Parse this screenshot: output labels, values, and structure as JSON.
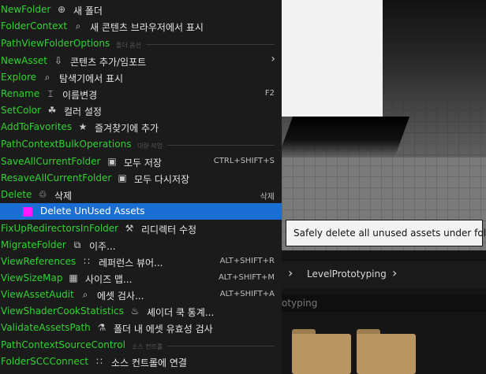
{
  "menu": {
    "items": [
      {
        "name": "NewFolder",
        "icon": "⊕",
        "label": "새 폴더",
        "shortcut": ""
      },
      {
        "name": "FolderContext",
        "icon": "⌕",
        "label": "새 콘텐츠 브라우저에서 표시",
        "shortcut": ""
      },
      {
        "name": "PathViewFolderOptions",
        "section": "폴더 옵션"
      },
      {
        "name": "NewAsset",
        "icon": "⇩",
        "label": "콘텐츠 추가/임포트",
        "shortcut": "",
        "submenu": "›"
      },
      {
        "name": "Explore",
        "icon": "⌕",
        "label": "탐색기에서 표시",
        "shortcut": ""
      },
      {
        "name": "Rename",
        "icon": "⌶",
        "label": "이름변경",
        "shortcut": "F2"
      },
      {
        "name": "SetColor",
        "icon": "☘",
        "label": "컬러 설정",
        "shortcut": ""
      },
      {
        "name": "AddToFavorites",
        "icon": "★",
        "label": "즐겨찾기에 추가",
        "shortcut": ""
      },
      {
        "name": "PathContextBulkOperations",
        "section": "대량 작업"
      },
      {
        "name": "SaveAllCurrentFolder",
        "icon": "▣",
        "label": "모두 저장",
        "shortcut": "CTRL+SHIFT+S"
      },
      {
        "name": "ResaveAllCurrentFolder",
        "icon": "▣",
        "label": "모두 다시저장",
        "shortcut": ""
      },
      {
        "name": "Delete",
        "icon": "♲",
        "label": "삭제",
        "shortcut": "삭제"
      },
      {
        "name": "",
        "icon": "",
        "label": "Delete UnUsed Assets",
        "shortcut": "",
        "selected": true
      },
      {
        "name": "FixUpRedirectorsInFolder",
        "icon": "⚒",
        "label": "리디렉터 수정",
        "shortcut": ""
      },
      {
        "name": "MigrateFolder",
        "icon": "⧉",
        "label": "이주...",
        "shortcut": ""
      },
      {
        "name": "ViewReferences",
        "icon": "∷",
        "label": "레퍼런스 뷰어...",
        "shortcut": "ALT+SHIFT+R"
      },
      {
        "name": "ViewSizeMap",
        "icon": "▦",
        "label": "사이즈 맵...",
        "shortcut": "ALT+SHIFT+M"
      },
      {
        "name": "ViewAssetAudit",
        "icon": "⌕",
        "label": "에셋 검사...",
        "shortcut": "ALT+SHIFT+A"
      },
      {
        "name": "ViewShaderCookStatistics",
        "icon": "♨",
        "label": "셰이더 쿡 통계...",
        "shortcut": ""
      },
      {
        "name": "ValidateAssetsPath",
        "icon": "⚗",
        "label": "폴더 내 에셋 유효성 검사",
        "shortcut": ""
      },
      {
        "name": "PathContextSourceControl",
        "section": "소스 컨트롤"
      },
      {
        "name": "FolderSCCConnect",
        "icon": "∷",
        "label": "소스 컨트롤에 연결",
        "shortcut": ""
      }
    ]
  },
  "tooltip": {
    "text": "Safely delete all unused assets under folder"
  },
  "content_browser": {
    "breadcrumb": "LevelPrototyping",
    "chevron": "›",
    "search_text": "otyping"
  },
  "colors": {
    "menu_name": "#31d331",
    "selection": "#1b6fd4",
    "folder": "#b89563"
  }
}
